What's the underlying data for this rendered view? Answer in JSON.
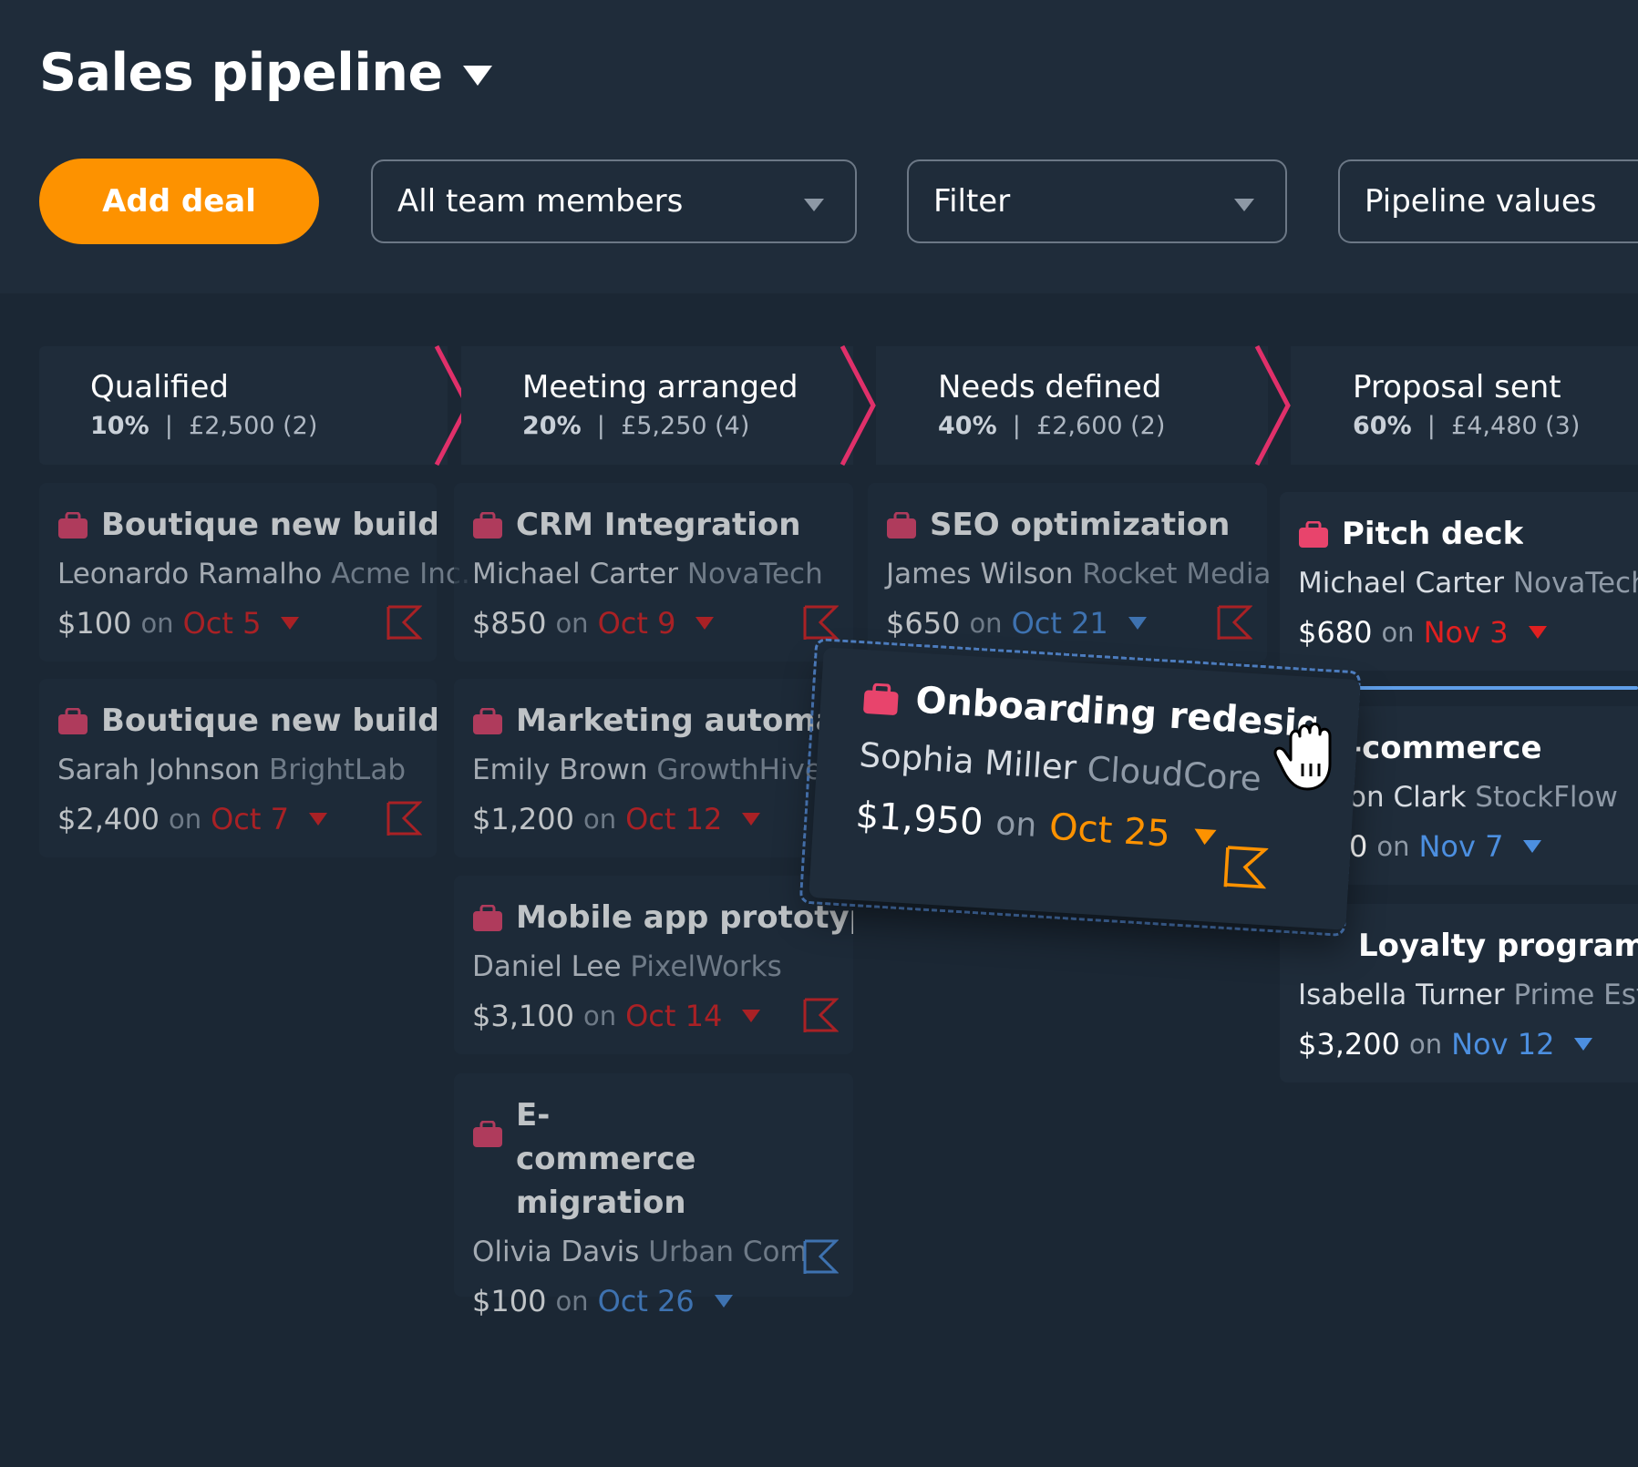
{
  "header": {
    "title": "Sales pipeline",
    "add_deal_label": "Add deal",
    "team_select": "All team members",
    "filter_select": "Filter",
    "pipeline_select": "Pipeline values"
  },
  "stages": [
    {
      "name": "Qualified",
      "percent": "10%",
      "value": "£2,500 (2)"
    },
    {
      "name": "Meeting arranged",
      "percent": "20%",
      "value": "£5,250 (4)"
    },
    {
      "name": "Needs defined",
      "percent": "40%",
      "value": "£2,600 (2)"
    },
    {
      "name": "Proposal sent",
      "percent": "60%",
      "value": "£4,480 (3)"
    }
  ],
  "on_word": "on",
  "cards": {
    "c1": {
      "title": "Boutique new build",
      "person": "Leonardo Ramalho",
      "org": "Acme Inc.",
      "amount": "$100",
      "date": "Oct 5"
    },
    "c2": {
      "title": "Boutique new build",
      "person": "Sarah Johnson",
      "org": "BrightLab",
      "amount": "$2,400",
      "date": "Oct 7"
    },
    "c3": {
      "title": "CRM Integration",
      "person": "Michael Carter",
      "org": "NovaTech",
      "amount": "$850",
      "date": "Oct 9"
    },
    "c4": {
      "title": "Marketing automatic",
      "person": "Emily Brown",
      "org": "GrowthHive",
      "amount": "$1,200",
      "date": "Oct 12"
    },
    "c5": {
      "title": "Mobile app prototype",
      "person": "Daniel Lee",
      "org": "PixelWorks",
      "amount": "$3,100",
      "date": "Oct 14"
    },
    "c6": {
      "title": "E-commerce migration",
      "person": "Olivia Davis",
      "org": "Urban Com",
      "amount": "$100",
      "date": "Oct 26"
    },
    "c7": {
      "title": "SEO optimization",
      "person": "James Wilson",
      "org": "Rocket Media",
      "amount": "$650",
      "date": "Oct 21"
    },
    "c8": {
      "title": "Pitch deck",
      "person": "Michael Carter",
      "org": "NovaTech",
      "amount": "$680",
      "date": "Nov 3"
    },
    "c9": {
      "title": "-commerce",
      "person": "on Clark",
      "org": "StockFlow",
      "amount": "0",
      "date": "Nov 7"
    },
    "c10": {
      "title": "Loyalty program",
      "person": "Isabella Turner",
      "org": "Prime Estat",
      "amount": "$3,200",
      "date": "Nov 12"
    },
    "drag": {
      "title": "Onboarding redesig",
      "person": "Sophia Miller",
      "org": "CloudCore",
      "amount": "$1,950",
      "date": "Oct 25"
    }
  },
  "colors": {
    "accent_orange": "#fd9200",
    "overdue_red": "#e02020",
    "upcoming_blue": "#4c8fe0",
    "stage_chevron": "#e0306a",
    "bag_pink": "#e8446c"
  },
  "icons": [
    "chevron-down-icon",
    "briefcase-icon",
    "flag-icon",
    "hand-grab-cursor-icon"
  ]
}
